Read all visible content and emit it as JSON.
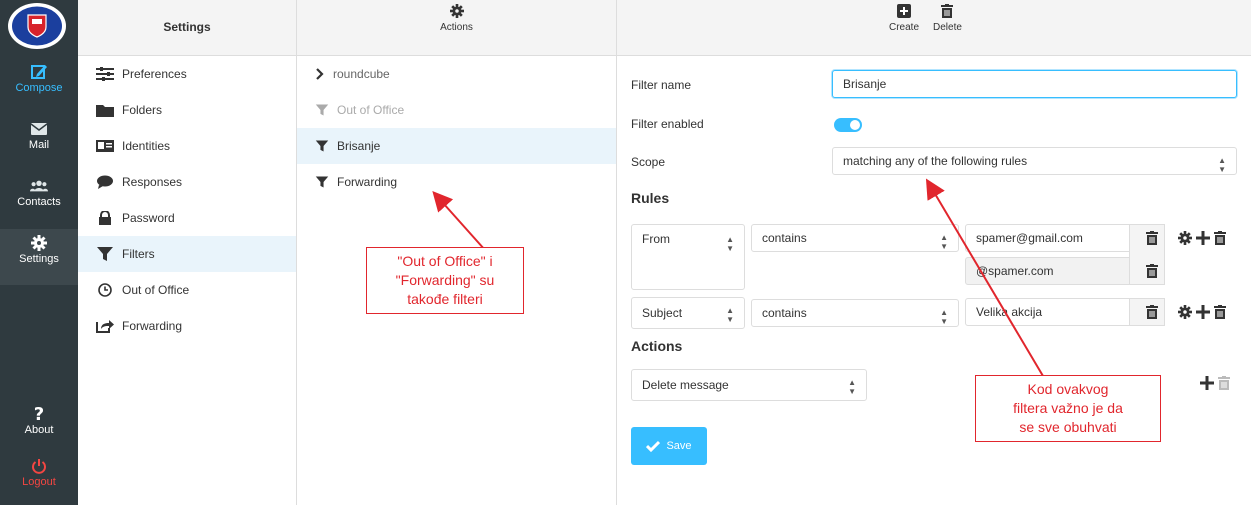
{
  "taskmenu": {
    "items": [
      {
        "label": "Compose",
        "icon": "compose-icon"
      },
      {
        "label": "Mail",
        "icon": "mail-icon"
      },
      {
        "label": "Contacts",
        "icon": "contacts-icon"
      },
      {
        "label": "Settings",
        "icon": "gear-icon"
      },
      {
        "label": "About",
        "icon": "question-icon"
      },
      {
        "label": "Logout",
        "icon": "power-icon"
      }
    ]
  },
  "settings": {
    "title": "Settings",
    "items": [
      {
        "label": "Preferences",
        "icon": "sliders-icon"
      },
      {
        "label": "Folders",
        "icon": "folder-icon"
      },
      {
        "label": "Identities",
        "icon": "id-card-icon"
      },
      {
        "label": "Responses",
        "icon": "comment-icon"
      },
      {
        "label": "Password",
        "icon": "lock-icon"
      },
      {
        "label": "Filters",
        "icon": "filter-icon"
      },
      {
        "label": "Out of Office",
        "icon": "clock-icon"
      },
      {
        "label": "Forwarding",
        "icon": "share-icon"
      }
    ]
  },
  "filters": {
    "actions_label": "Actions",
    "items": [
      {
        "label": "roundcube",
        "icon": "chevron-right-icon"
      },
      {
        "label": "Out of Office",
        "icon": "filter-icon"
      },
      {
        "label": "Brisanje",
        "icon": "filter-icon"
      },
      {
        "label": "Forwarding",
        "icon": "filter-icon"
      }
    ]
  },
  "main": {
    "toolbar": {
      "create": "Create",
      "delete": "Delete"
    },
    "filter_name_label": "Filter name",
    "filter_name_value": "Brisanje",
    "filter_enabled_label": "Filter enabled",
    "filter_enabled": true,
    "scope_label": "Scope",
    "scope_value": "matching any of the following rules",
    "rules_title": "Rules",
    "rules": [
      {
        "header": "From",
        "op": "contains",
        "values": [
          "spamer@gmail.com",
          "@spamer.com"
        ]
      },
      {
        "header": "Subject",
        "op": "contains",
        "values": [
          "Velika akcija"
        ]
      }
    ],
    "actions_title": "Actions",
    "action_value": "Delete message",
    "save_label": "Save"
  },
  "annotations": {
    "callout1": [
      "\"Out of Office\" i",
      "\"Forwarding\" su",
      "takođe filteri"
    ],
    "callout2": [
      "Kod ovakvog",
      "filtera važno je da",
      "se sve obuhvati"
    ]
  },
  "colors": {
    "accent": "#37beff",
    "annotation": "#e1262d",
    "sidebar": "#2f3a3f"
  }
}
